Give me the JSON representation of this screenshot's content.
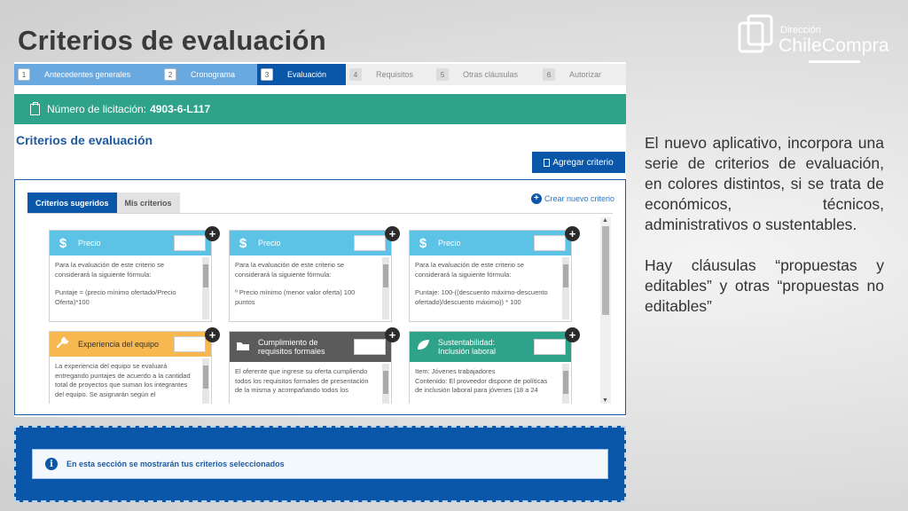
{
  "slide": {
    "title": "Criterios de evaluación",
    "paragraphs": [
      "El nuevo aplicativo, incorpora una serie de criterios de evaluación, en colores distintos, si se trata de económicos, técnicos, administrativos o sustentables.",
      "Hay cláusulas “propuestas y editables” y otras “propuestas no editables”"
    ]
  },
  "logo": {
    "small": "Dirección",
    "big": "ChileCompra"
  },
  "wizard": {
    "steps": [
      {
        "num": "1",
        "label": "Antecedentes generales",
        "state": "done"
      },
      {
        "num": "2",
        "label": "Cronograma",
        "state": "done"
      },
      {
        "num": "3",
        "label": "Evaluación",
        "state": "active"
      },
      {
        "num": "4",
        "label": "Requisitos",
        "state": "todo"
      },
      {
        "num": "5",
        "label": "Otras cláusulas",
        "state": "todo"
      },
      {
        "num": "6",
        "label": "Autorizar",
        "state": "todo"
      }
    ]
  },
  "licitacion": {
    "label": "Número de licitación:",
    "number": "4903-6-L117"
  },
  "section": {
    "title": "Criterios de evaluación",
    "add_button": "Agregar criterio",
    "tabs": [
      {
        "label": "Criterios sugeridos",
        "active": true
      },
      {
        "label": "Mis criterios",
        "active": false
      }
    ],
    "create_link": "Crear nuevo criterio",
    "cards": [
      {
        "title": "Precio",
        "icon": "dollar-icon",
        "glyph": "$",
        "color": "#5cc3e6",
        "lines": [
          "Para la evaluación de este criterio se considerará la siguiente fórmula:",
          "",
          "Puntaje = (precio mínimo ofertado/Precio Oferta)*100"
        ]
      },
      {
        "title": "Precio",
        "icon": "dollar-icon",
        "glyph": "$",
        "color": "#5cc3e6",
        "lines": [
          "Para la evaluación de este criterio se considerará la siguiente fórmula:",
          "",
          "º  Precio mínimo (menor valor oferta) 100 puntos"
        ]
      },
      {
        "title": "Precio",
        "icon": "dollar-icon",
        "glyph": "$",
        "color": "#5cc3e6",
        "lines": [
          "Para la evaluación de este criterio se considerará la siguiente fórmula:",
          "",
          "Puntaje: 100-((descuento máximo-descuento ofertado)/descuento máximo)) * 100"
        ]
      },
      {
        "title": "Experiencia del equipo",
        "icon": "wrench-icon",
        "glyph": "🔧",
        "color": "#f7b84f",
        "lines": [
          "La experiencia del equipo se evaluará entregando puntajes de acuerdo a la cantidad total de proyectos que suman los integrantes del equipo. Se asignarán según el"
        ]
      },
      {
        "title": "Cumplimiento de requisitos formales",
        "icon": "folder-icon",
        "glyph": "▬",
        "color": "#5b5b5b",
        "lines": [
          "El oferente que ingrese su oferta cumpliendo todos los requisitos formales de presentación de la misma y acompañando todos los"
        ]
      },
      {
        "title": "Sustentabilidad: Inclusión laboral",
        "icon": "leaf-icon",
        "glyph": "❧",
        "color": "#2fa38a",
        "lines": [
          "Item: Jóvenes trabajadores",
          "Contenido: El proveedor dispone de políticas de inclusión laboral para jóvenes (18 a 24"
        ]
      }
    ],
    "selected_info": "En esta sección se mostrarán tus criterios seleccionados"
  }
}
